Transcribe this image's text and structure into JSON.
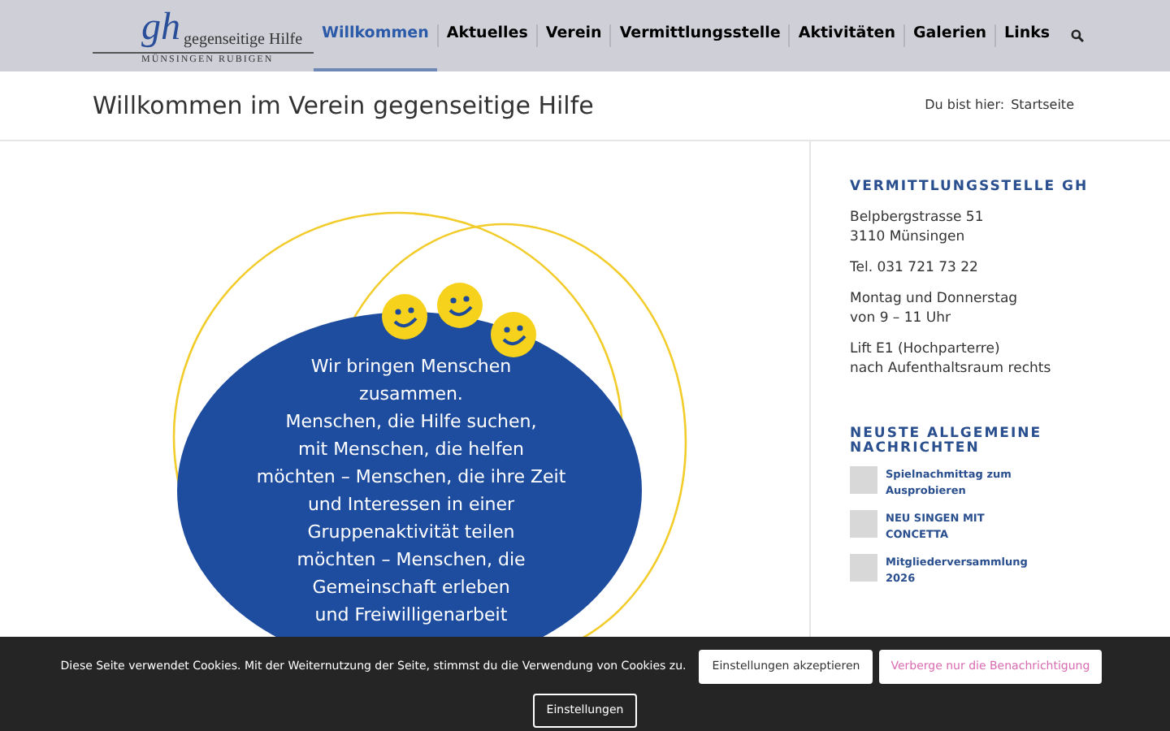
{
  "logo": {
    "mark": "gh",
    "name": "gegenseitige Hilfe",
    "place": "MÜNSINGEN RUBIGEN"
  },
  "nav": [
    {
      "label": "Willkommen",
      "selected": true
    },
    {
      "label": "Aktuelles",
      "selected": false
    },
    {
      "label": "Verein",
      "selected": false
    },
    {
      "label": "Vermittlungsstelle",
      "selected": false
    },
    {
      "label": "Aktivitäten",
      "selected": false
    },
    {
      "label": "Galerien",
      "selected": false
    },
    {
      "label": "Links",
      "selected": false
    }
  ],
  "page_title": "Willkommen im Verein gegenseitige Hilfe",
  "breadcrumb": {
    "prefix": "Du bist hier:",
    "current": "Startseite"
  },
  "graphic_lines": [
    "Wir bringen Menschen",
    "zusammen.",
    "Menschen, die Hilfe suchen,",
    "mit Menschen, die helfen",
    "möchten – Menschen, die ihre Zeit",
    "und Interessen in einer",
    "Gruppenaktivität teilen",
    "möchten – Menschen, die",
    "Gemeinschaft erleben",
    "und Freiwilligenarbeit"
  ],
  "sidebar": {
    "contact_heading": "VERMITTLUNGSSTELLE GH",
    "contact_blocks": [
      [
        "Belpbergstrasse 51",
        "3110 Münsingen"
      ],
      [
        "Tel. 031 721 73 22"
      ],
      [
        "Montag und Donnerstag",
        "von 9 – 11 Uhr"
      ],
      [
        "Lift E1 (Hochparterre)",
        "nach Aufenthaltsraum rechts"
      ]
    ],
    "news_heading": "NEUSTE ALLGEMEINE NACHRICHTEN",
    "news": [
      "Spielnachmittag zum Ausprobieren",
      "NEU SINGEN MIT CONCETTA",
      "Mitgliederversammlung 2026"
    ]
  },
  "cookie_bar": {
    "text": "Diese Seite verwendet Cookies. Mit der Weiternutzung der Seite, stimmst du die Verwendung von Cookies zu.",
    "accept": "Einstellungen akzeptieren",
    "hide": "Verberge nur die Benachrichtigung",
    "settings": "Einstellungen"
  }
}
